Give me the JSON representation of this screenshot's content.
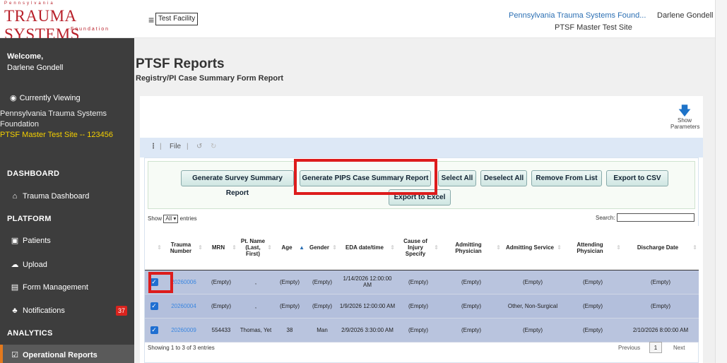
{
  "header": {
    "logo_top": "Pennsylvania",
    "logo_main": "TRAUMA SYSTEMS",
    "logo_bottom": "Foundation",
    "facility_button": "Test Facility",
    "org_name": "Pennsylvania Trauma Systems Found...",
    "site_name": "PTSF Master Test Site",
    "user_name": "Darlene Gondell"
  },
  "sidebar": {
    "welcome": "Welcome,",
    "welcome_name": "Darlene Gondell",
    "currently_viewing": "Currently Viewing",
    "viewing_org": "Pennsylvania Trauma Systems Foundation",
    "viewing_site": "PTSF Master Test Site -- 123456",
    "sections": {
      "dashboard": "DASHBOARD",
      "platform": "PLATFORM",
      "analytics": "ANALYTICS"
    },
    "items": {
      "trauma_dashboard": "Trauma Dashboard",
      "patients": "Patients",
      "upload": "Upload",
      "form_management": "Form Management",
      "notifications": "Notifications",
      "notifications_count": "37",
      "operational_reports": "Operational Reports"
    }
  },
  "main": {
    "title": "PTSF Reports",
    "subtitle": "Registry/PI Case Summary Form Report",
    "show_parameters": "Show Parameters",
    "toolbar": {
      "file": "File"
    },
    "buttons": {
      "survey_summary": "Generate Survey Summary Report",
      "pips_summary": "Generate PIPS Case Summary Report",
      "select_all": "Select All",
      "deselect_all": "Deselect All",
      "remove_from_list": "Remove From List",
      "export_csv": "Export to CSV",
      "export_excel": "Export to Excel"
    },
    "table_controls": {
      "show": "Show",
      "show_value": "All",
      "entries": "entries",
      "search": "Search:"
    },
    "columns": [
      "Trauma Number",
      "MRN",
      "Pt. Name (Last, First)",
      "Age",
      "Gender",
      "EDA date/time",
      "Cause of Injury Specify",
      "Admitting Physician",
      "Admitting Service",
      "Attending Physician",
      "Discharge Date"
    ],
    "rows": [
      {
        "trauma_number": "20260006",
        "mrn": "(Empty)",
        "name": ",",
        "age": "(Empty)",
        "gender": "(Empty)",
        "eda": "1/14/2026 12:00:00 AM",
        "cause": "(Empty)",
        "adm_phys": "(Empty)",
        "adm_service": "(Empty)",
        "att_phys": "(Empty)",
        "discharge": "(Empty)"
      },
      {
        "trauma_number": "20260004",
        "mrn": "(Empty)",
        "name": ",",
        "age": "(Empty)",
        "gender": "(Empty)",
        "eda": "1/9/2026 12:00:00 AM",
        "cause": "(Empty)",
        "adm_phys": "(Empty)",
        "adm_service": "Other, Non-Surgical",
        "att_phys": "(Empty)",
        "discharge": "(Empty)"
      },
      {
        "trauma_number": "20260009",
        "mrn": "554433",
        "name": "Thomas, Yet",
        "age": "38",
        "gender": "Man",
        "eda": "2/9/2026 3:30:00 AM",
        "cause": "(Empty)",
        "adm_phys": "(Empty)",
        "adm_service": "(Empty)",
        "att_phys": "(Empty)",
        "discharge": "2/10/2026 8:00:00 AM"
      }
    ],
    "info": "Showing 1 to 3 of 3 entries",
    "pager": {
      "previous": "Previous",
      "page": "1",
      "next": "Next"
    },
    "highlight_color": "#dd1c1c"
  }
}
